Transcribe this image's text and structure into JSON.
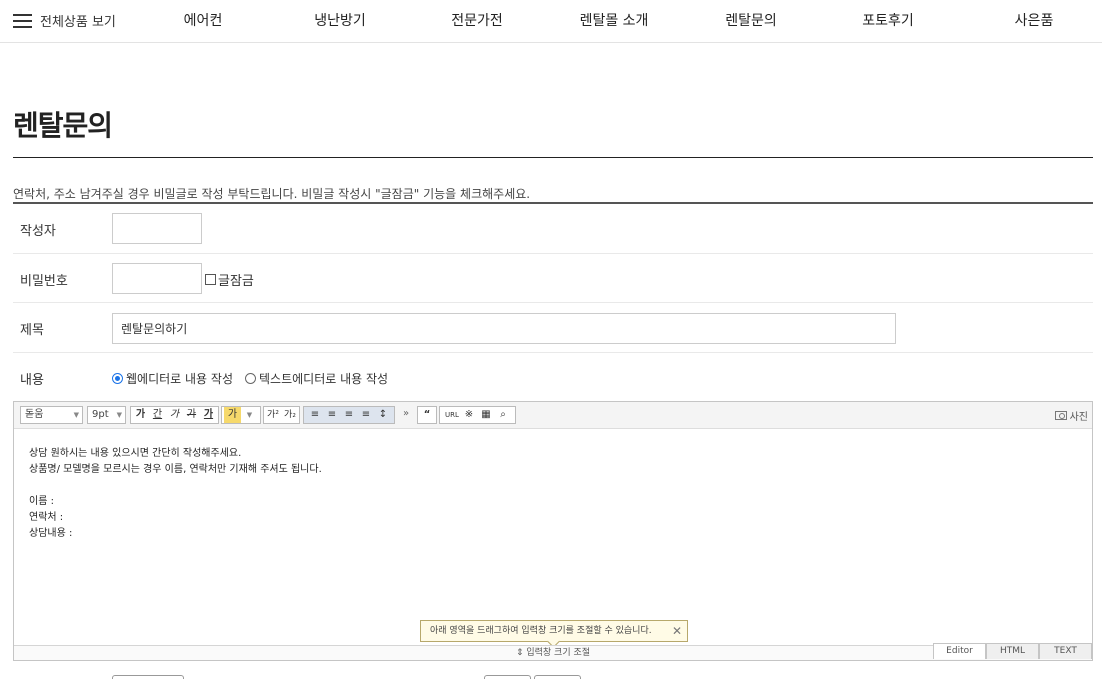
{
  "nav": {
    "menu_label": "전체상품 보기",
    "items": [
      "에어컨",
      "냉난방기",
      "전문가전",
      "렌탈몰 소개",
      "렌탈문의",
      "포토후기",
      "사은품"
    ]
  },
  "page": {
    "title": "렌탈문의",
    "notice": "연락처, 주소 남겨주실 경우 비밀글로 작성 부탁드립니다. 비밀글 작성시 \"글잠금\" 기능을 체크해주세요."
  },
  "form": {
    "author_label": "작성자",
    "author_value": "",
    "password_label": "비밀번호",
    "password_value": "",
    "lock_label": "글잠금",
    "subject_label": "제목",
    "subject_value": "렌탈문의하기",
    "content_label": "내용",
    "mode_web": "웹에디터로 내용 작성",
    "mode_text": "텍스트에디터로 내용 작성",
    "selected_mode": "web"
  },
  "editor": {
    "font_select": "돋움",
    "size_select": "9pt",
    "style_buttons": [
      "가",
      "간",
      "가",
      "가",
      "가"
    ],
    "color_buttons": [
      "가",
      "가"
    ],
    "script_buttons": [
      "가²",
      "가₂"
    ],
    "photo_label": "사진",
    "body_lines": [
      "상담 원하시는 내용 있으시면 간단히 작성해주세요.",
      "상품명/ 모델명을 모르시는 경우 이름, 연락처만 기재해 주셔도 됩니다.",
      "",
      "이름 :",
      "연락처 :",
      "상담내용 :"
    ],
    "tooltip": "아래 영역을 드래그하여 입력창 크기를 조절할 수 있습니다.",
    "resize_label": "입력창 크기 조절",
    "tabs": [
      "Editor",
      "HTML",
      "TEXT"
    ],
    "active_tab": "Editor"
  }
}
